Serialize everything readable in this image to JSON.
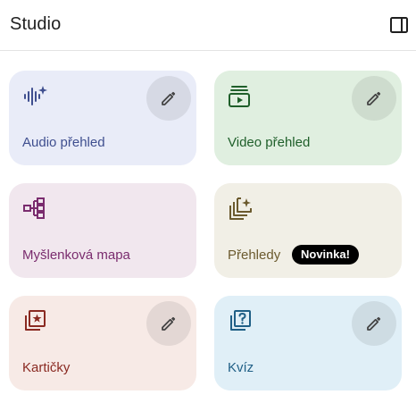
{
  "header": {
    "title": "Studio",
    "toggle_icon": "side-panel-icon"
  },
  "cards": {
    "audio": {
      "label": "Audio přehled",
      "icon": "audio-waveform-sparkle-icon",
      "color": "#3f4f8f",
      "background": "#e9ecf8"
    },
    "video": {
      "label": "Video přehled",
      "icon": "video-stack-icon",
      "color": "#1f5f2a",
      "background": "#e0efe0"
    },
    "mindmap": {
      "label": "Myšlenková mapa",
      "icon": "mind-map-icon",
      "color": "#7a2c6e",
      "background": "#f1e7ee"
    },
    "reports": {
      "label": "Přehledy",
      "icon": "reports-sparkle-icon",
      "color": "#6b5a2e",
      "background": "#f1efe6",
      "badge": "Novinka!"
    },
    "flashcards": {
      "label": "Kartičky",
      "icon": "flashcards-star-icon",
      "color": "#8a2a22",
      "background": "#f7eae6"
    },
    "quiz": {
      "label": "Kvíz",
      "icon": "quiz-question-icon",
      "color": "#1f5f86",
      "background": "#e0eff7"
    }
  },
  "edit_icon": "pencil-icon"
}
